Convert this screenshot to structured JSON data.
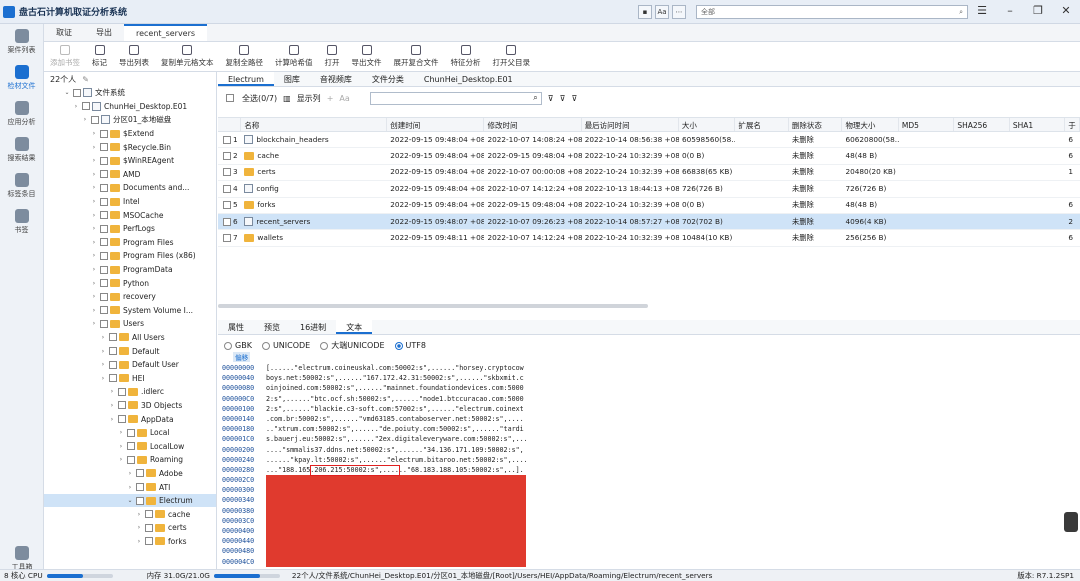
{
  "title": "盘古石计算机取证分析系统",
  "header": {
    "tools": [
      "Aa",
      "全部"
    ],
    "search_placeholder": "全部"
  },
  "leftnav": {
    "items": [
      "案件列表",
      "检材文件",
      "应用分析",
      "搜索结果",
      "标签条目",
      "书签"
    ],
    "bottom": "工具箱"
  },
  "tabs": [
    "取证",
    "导出",
    "recent_servers"
  ],
  "toolbar": [
    "添加书签",
    "标记",
    "导出列表",
    "复制单元格文本",
    "复制全路径",
    "计算哈希值",
    "打开",
    "导出文件",
    "展开复合文件",
    "特征分析",
    "打开父目录"
  ],
  "tree": {
    "head": "22个人",
    "rows": [
      {
        "label": "文件系统",
        "indent": 1,
        "type": "file"
      },
      {
        "label": "ChunHei_Desktop.E01",
        "indent": 2,
        "type": "file"
      },
      {
        "label": "分区01_本地磁盘",
        "indent": 3,
        "type": "file"
      },
      {
        "label": "$Extend",
        "indent": 4,
        "type": "folder"
      },
      {
        "label": "$Recycle.Bin",
        "indent": 4,
        "type": "folder"
      },
      {
        "label": "$WinREAgent",
        "indent": 4,
        "type": "folder"
      },
      {
        "label": "AMD",
        "indent": 4,
        "type": "folder"
      },
      {
        "label": "Documents and...",
        "indent": 4,
        "type": "folder"
      },
      {
        "label": "Intel",
        "indent": 4,
        "type": "folder"
      },
      {
        "label": "MSOCache",
        "indent": 4,
        "type": "folder"
      },
      {
        "label": "PerfLogs",
        "indent": 4,
        "type": "folder"
      },
      {
        "label": "Program Files",
        "indent": 4,
        "type": "folder"
      },
      {
        "label": "Program Files (x86)",
        "indent": 4,
        "type": "folder"
      },
      {
        "label": "ProgramData",
        "indent": 4,
        "type": "folder"
      },
      {
        "label": "Python",
        "indent": 4,
        "type": "folder"
      },
      {
        "label": "recovery",
        "indent": 4,
        "type": "folder"
      },
      {
        "label": "System Volume I...",
        "indent": 4,
        "type": "folder"
      },
      {
        "label": "Users",
        "indent": 4,
        "type": "folder"
      },
      {
        "label": "All Users",
        "indent": 5,
        "type": "folder"
      },
      {
        "label": "Default",
        "indent": 5,
        "type": "folder"
      },
      {
        "label": "Default User",
        "indent": 5,
        "type": "folder"
      },
      {
        "label": "HEI",
        "indent": 5,
        "type": "folder"
      },
      {
        "label": ".idlerc",
        "indent": 6,
        "type": "folder"
      },
      {
        "label": "3D Objects",
        "indent": 6,
        "type": "folder"
      },
      {
        "label": "AppData",
        "indent": 6,
        "type": "folder"
      },
      {
        "label": "Local",
        "indent": 7,
        "type": "folder"
      },
      {
        "label": "LocalLow",
        "indent": 7,
        "type": "folder"
      },
      {
        "label": "Roaming",
        "indent": 7,
        "type": "folder"
      },
      {
        "label": "Adobe",
        "indent": 8,
        "type": "folder"
      },
      {
        "label": "ATI",
        "indent": 8,
        "type": "folder"
      },
      {
        "label": "Electrum",
        "indent": 8,
        "type": "folder",
        "selected": true
      },
      {
        "label": "cache",
        "indent": 9,
        "type": "folder"
      },
      {
        "label": "certs",
        "indent": 9,
        "type": "folder"
      },
      {
        "label": "forks",
        "indent": 9,
        "type": "folder"
      }
    ]
  },
  "subtabs": [
    "Electrum",
    "图库",
    "音视频库",
    "文件分类",
    "ChunHei_Desktop.E01"
  ],
  "listbar": {
    "select_all": "全选(0/7)",
    "show_col": "显示列"
  },
  "table": {
    "headers": [
      "名称",
      "创建时间",
      "修改时间",
      "最后访问时间",
      "大小",
      "扩展名",
      "删除状态",
      "物理大小",
      "MD5",
      "SHA256",
      "SHA1",
      "于"
    ],
    "rows": [
      {
        "num": "1",
        "name": "blockchain_headers",
        "type": "file",
        "created": "2022-09-15 09:48:04 +08",
        "modified": "2022-10-07 14:08:24 +08",
        "accessed": "2022-10-14 08:56:38 +08",
        "size": "60598560(58...",
        "ext": "",
        "del": "未删除",
        "psize": "60620800(58...",
        "tail": "6"
      },
      {
        "num": "2",
        "name": "cache",
        "type": "folder",
        "created": "2022-09-15 09:48:04 +08",
        "modified": "2022-09-15 09:48:04 +08",
        "accessed": "2022-10-24 10:32:39 +08",
        "size": "0(0 B)",
        "ext": "",
        "del": "未删除",
        "psize": "48(48 B)",
        "tail": "6"
      },
      {
        "num": "3",
        "name": "certs",
        "type": "folder",
        "created": "2022-09-15 09:48:04 +08",
        "modified": "2022-10-07 00:00:08 +08",
        "accessed": "2022-10-24 10:32:39 +08",
        "size": "66838(65 KB)",
        "ext": "",
        "del": "未删除",
        "psize": "20480(20 KB)",
        "tail": "1"
      },
      {
        "num": "4",
        "name": "config",
        "type": "file",
        "created": "2022-09-15 09:48:04 +08",
        "modified": "2022-10-07 14:12:24 +08",
        "accessed": "2022-10-13 18:44:13 +08",
        "size": "726(726 B)",
        "ext": "",
        "del": "未删除",
        "psize": "726(726 B)",
        "tail": ""
      },
      {
        "num": "5",
        "name": "forks",
        "type": "folder",
        "created": "2022-09-15 09:48:04 +08",
        "modified": "2022-09-15 09:48:04 +08",
        "accessed": "2022-10-24 10:32:39 +08",
        "size": "0(0 B)",
        "ext": "",
        "del": "未删除",
        "psize": "48(48 B)",
        "tail": "6"
      },
      {
        "num": "6",
        "name": "recent_servers",
        "type": "file",
        "created": "2022-09-15 09:48:07 +08",
        "modified": "2022-10-07 09:26:23 +08",
        "accessed": "2022-10-14 08:57:27 +08",
        "size": "702(702 B)",
        "ext": "",
        "del": "未删除",
        "psize": "4096(4 KB)",
        "tail": "2",
        "selected": true
      },
      {
        "num": "7",
        "name": "wallets",
        "type": "folder",
        "created": "2022-09-15 09:48:11 +08",
        "modified": "2022-10-07 14:12:24 +08",
        "accessed": "2022-10-24 10:32:39 +08",
        "size": "10484(10 KB)",
        "ext": "",
        "del": "未删除",
        "psize": "256(256 B)",
        "tail": "6"
      }
    ]
  },
  "lowertabs": [
    "属性",
    "预览",
    "16进制",
    "文本"
  ],
  "encodings": [
    "GBK",
    "UNICODE",
    "大端UNICODE",
    "UTF8"
  ],
  "hex": {
    "offset_label": "偏移",
    "offsets": [
      "00000000",
      "00000040",
      "00000080",
      "000000C0",
      "00000100",
      "00000140",
      "00000180",
      "000001C0",
      "00000200",
      "00000240",
      "00000280",
      "000002C0",
      "00000300",
      "00000340",
      "00000380",
      "000003C0",
      "00000400",
      "00000440",
      "00000480",
      "000004C0"
    ],
    "text_lines": [
      "[......\"electrum.coineuskal.com:50002:s\",......\"horsey.cryptocow",
      "boys.net:50002:s\",......\"167.172.42.31:50002:s\",......\"skbxmit.c",
      "oinjoined.com:50002:s\",......\"mainnet.foundationdevices.com:5000",
      "2:s\",......\"btc.ocf.sh:50002:s\",......\"node1.btccuracao.com:5000",
      "2:s\",......\"blackie.c3-soft.com:57002:s\",......\"electrum.coinext",
      ".com.br:50002:s\",......\"vmd63185.contaboserver.net:50002:s\",....",
      "..\"xtrum.com:50002:s\",......\"de.poiuty.com:50002:s\",......\"tardi",
      "s.bauerj.eu:50002:s\",......\"2ex.digitaleveryware.com:50002:s\",...",
      "....\"smmalis37.ddns.net:50002:s\",......\"34.136.171.109:50002:s\",",
      "......\"kpay.lt:50002:s\",......\"electrum.bitaroo.net:50002:s\",....",
      "...\"188.165.206.215:50002:s\",......\"68.183.188.105:50002:s\",..]."
    ],
    "red_lines": 9
  },
  "status": {
    "cpu": "8 核心 CPU",
    "cpu_fraction": 0.55,
    "mem": "内存 31.0G/21.0G",
    "mem_fraction": 0.7,
    "path": "22个人/文件系统/ChunHei_Desktop.E01/分区01_本地磁盘/[Root]/Users/HEI/AppData/Roaming/Electrum/recent_servers",
    "version": "版本: R7.1.2SP1"
  }
}
